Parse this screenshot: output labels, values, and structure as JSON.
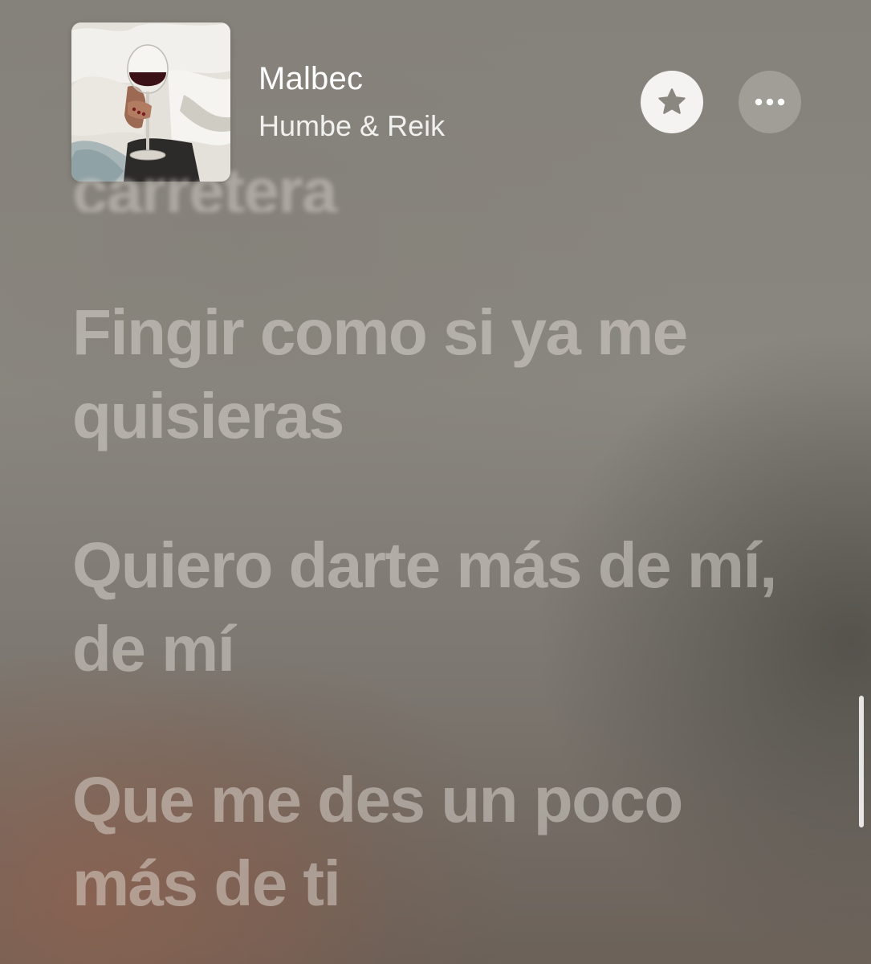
{
  "now_playing": {
    "title": "Malbec",
    "artist": "Humbe & Reik",
    "artwork_icon": "album-artwork-wine-glass"
  },
  "controls": {
    "favorite_icon": "star-icon",
    "more_icon": "ellipsis-icon"
  },
  "lyrics": {
    "previous_partial": "carretera",
    "lines": [
      "Fingir como si ya me quisieras",
      "Quiero darte más de mí, de mí",
      "Que me des un poco más de ti"
    ]
  },
  "colors": {
    "favorite_button_bg": "#f4f3f1",
    "star_fill": "#8a8780",
    "lyric_text": "#ece6e0"
  }
}
